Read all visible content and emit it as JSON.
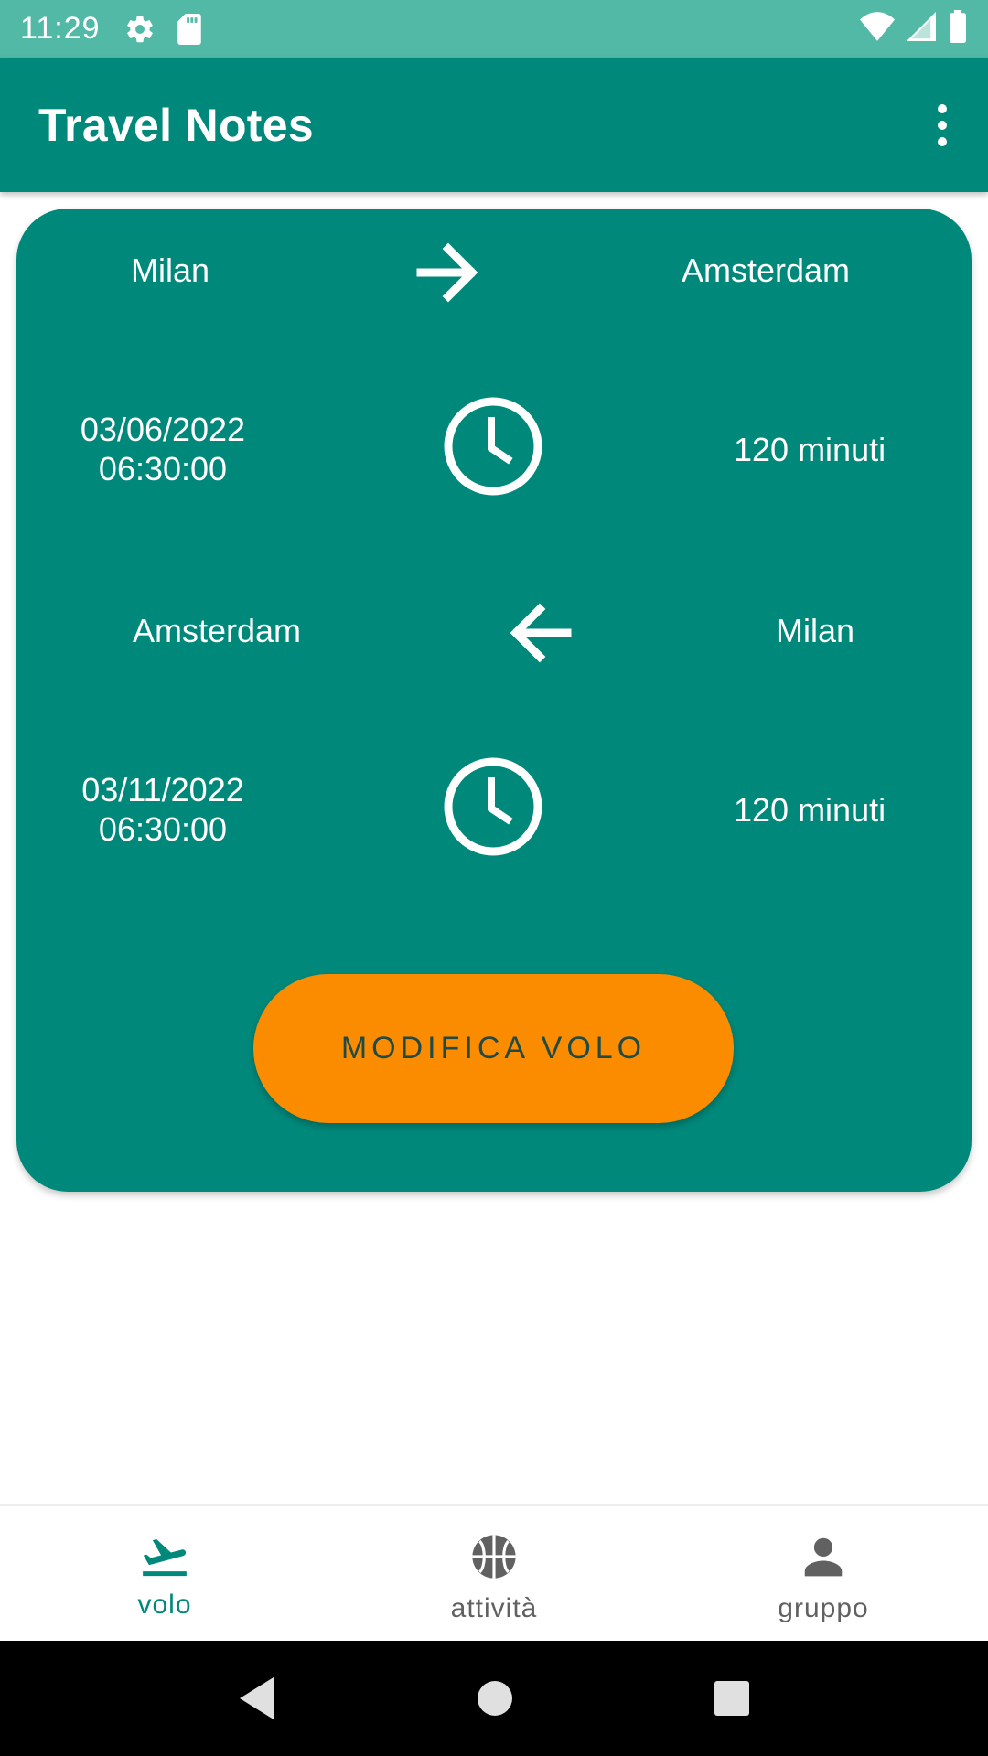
{
  "status_bar": {
    "time": "11:29",
    "icons": [
      "gear-icon",
      "sd-card-icon",
      "wifi-icon",
      "signal-icon",
      "battery-icon"
    ]
  },
  "app_bar": {
    "title": "Travel Notes",
    "menu_icon": "more-vert-icon"
  },
  "flight": {
    "outbound": {
      "from": "Milan",
      "to": "Amsterdam",
      "date": "03/06/2022",
      "time": "06:30:00",
      "duration": "120 minuti"
    },
    "return": {
      "from": "Amsterdam",
      "to": "Milan",
      "date": "03/11/2022",
      "time": "06:30:00",
      "duration": "120 minuti"
    },
    "edit_button_label": "MODIFICA VOLO"
  },
  "bottom_nav": {
    "items": [
      {
        "label": "volo",
        "icon": "flight-takeoff-icon",
        "active": true
      },
      {
        "label": "attività",
        "icon": "basketball-icon",
        "active": false
      },
      {
        "label": "gruppo",
        "icon": "person-icon",
        "active": false
      }
    ]
  },
  "system_nav": {
    "icons": [
      "back-icon",
      "home-icon",
      "recents-icon"
    ]
  },
  "colors": {
    "primary": "#00897b",
    "status_bar": "#52b9a7",
    "accent": "#fb8c00",
    "inactive": "#616161"
  }
}
